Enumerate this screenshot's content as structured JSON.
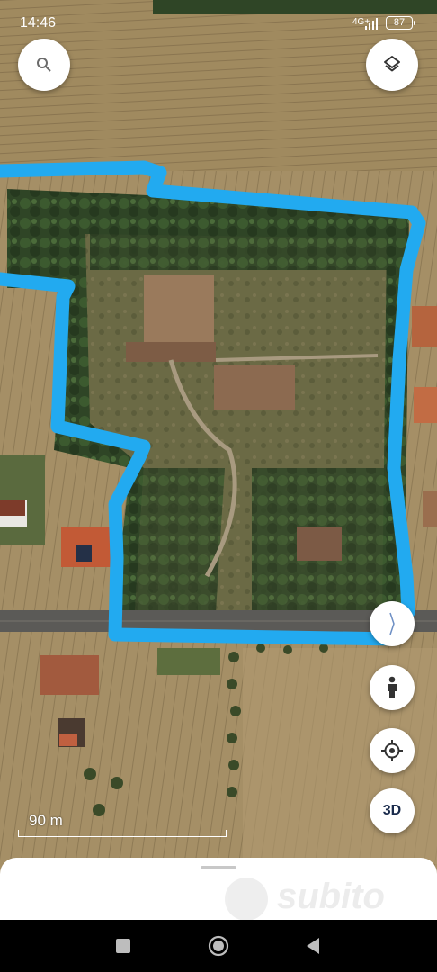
{
  "status_bar": {
    "time": "14:46",
    "network": "4G+",
    "battery": "87"
  },
  "map": {
    "scale_label": "90 m",
    "boundary_color": "#22aaf0",
    "compass_icon": "compass-needle-icon"
  },
  "buttons": {
    "search_icon": "search-icon",
    "layers_icon": "layers-icon",
    "street_view_icon": "person-icon",
    "location_icon": "my-location-icon",
    "three_d_label": "3D"
  },
  "watermark": {
    "text": "subito"
  },
  "nav": {
    "recents": "square-icon",
    "home": "circle-icon",
    "back": "triangle-back-icon"
  }
}
